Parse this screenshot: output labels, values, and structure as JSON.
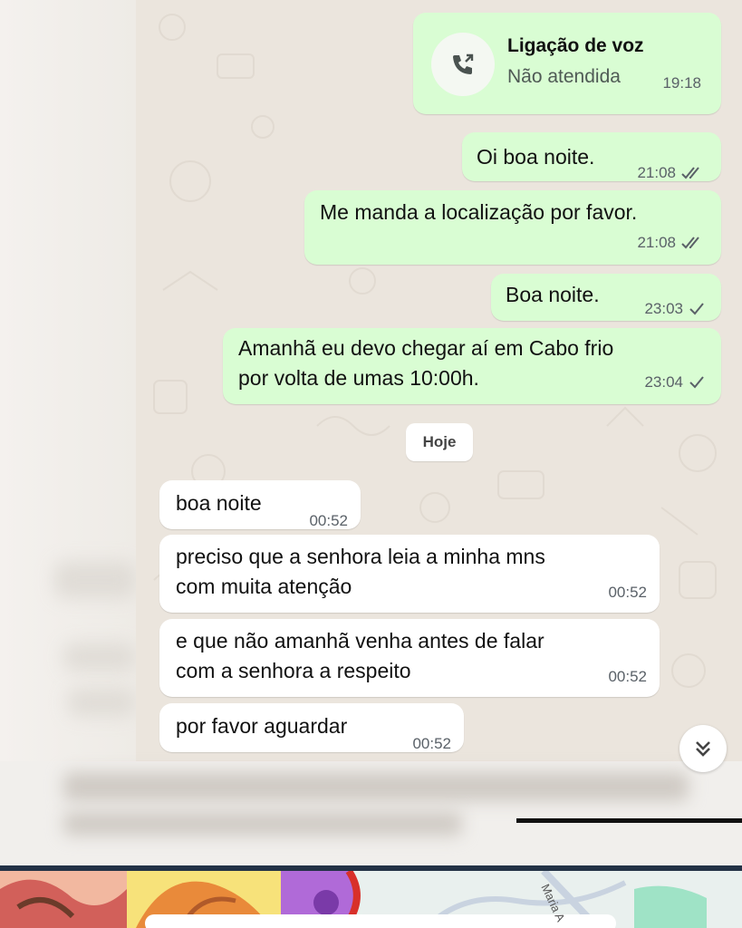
{
  "call": {
    "title": "Ligação de voz",
    "status": "Não atendida",
    "time": "19:18",
    "icon": "missed-call-icon"
  },
  "outgoing": [
    {
      "text": "Oi boa noite.",
      "time": "21:08",
      "status": "read"
    },
    {
      "text": "Me manda a localização por favor.",
      "time": "21:08",
      "status": "read"
    },
    {
      "text": "Boa noite.",
      "time": "23:03",
      "status": "sent"
    },
    {
      "line1": "Amanhã eu devo chegar aí em Cabo frio",
      "line2": "por volta de umas 10:00h.",
      "time": "23:04",
      "status": "sent"
    }
  ],
  "date_chip": "Hoje",
  "incoming": [
    {
      "text": "boa noite",
      "time": "00:52"
    },
    {
      "line1": "preciso que a senhora leia a minha mns",
      "line2": "com muita atenção",
      "time": "00:52"
    },
    {
      "line1": "e que não amanhã venha antes de falar",
      "line2": "com a senhora a respeito",
      "time": "00:52"
    },
    {
      "text": "por favor aguardar",
      "time": "00:52"
    }
  ],
  "map_label": "Maria A",
  "colors": {
    "outgoing_bubble": "#d9fdd3",
    "incoming_bubble": "#ffffff",
    "chat_bg": "#ebe5dd",
    "tick": "#5a6168"
  },
  "icons": {
    "read_tick": "double-check-icon",
    "sent_tick": "check-icon",
    "scroll": "double-chevron-down-icon"
  }
}
